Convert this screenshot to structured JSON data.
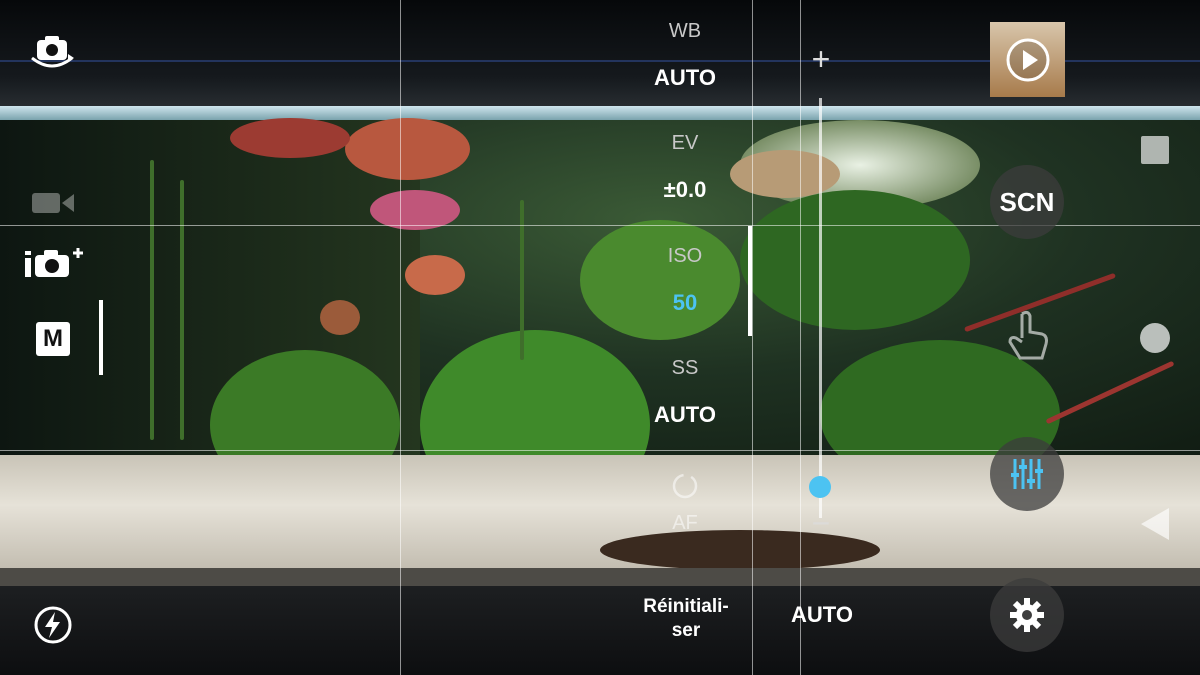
{
  "left_rail": {
    "switch_camera_icon": "switch-camera-icon",
    "video_mode_icon": "video-camera-icon",
    "add_mode_icon": "camera-plus-icon",
    "mode_label": "M",
    "flash_icon": "flash-auto-icon"
  },
  "params": {
    "wb": {
      "label": "WB",
      "value": "AUTO"
    },
    "ev": {
      "label": "EV",
      "value": "±0.0"
    },
    "iso": {
      "label": "ISO",
      "value": "50"
    },
    "ss": {
      "label": "SS",
      "value": "AUTO"
    },
    "af": {
      "label": "AF"
    }
  },
  "controls": {
    "reset_label": "Réinitiali-\nser",
    "focus_value": "AUTO",
    "slider_plus": "+",
    "slider_minus": "−",
    "slider_level": 0.05
  },
  "right_rail": {
    "scene_label": "SCN"
  },
  "colors": {
    "accent": "#4cc3f2",
    "iso_value": "#4cc3f2"
  }
}
